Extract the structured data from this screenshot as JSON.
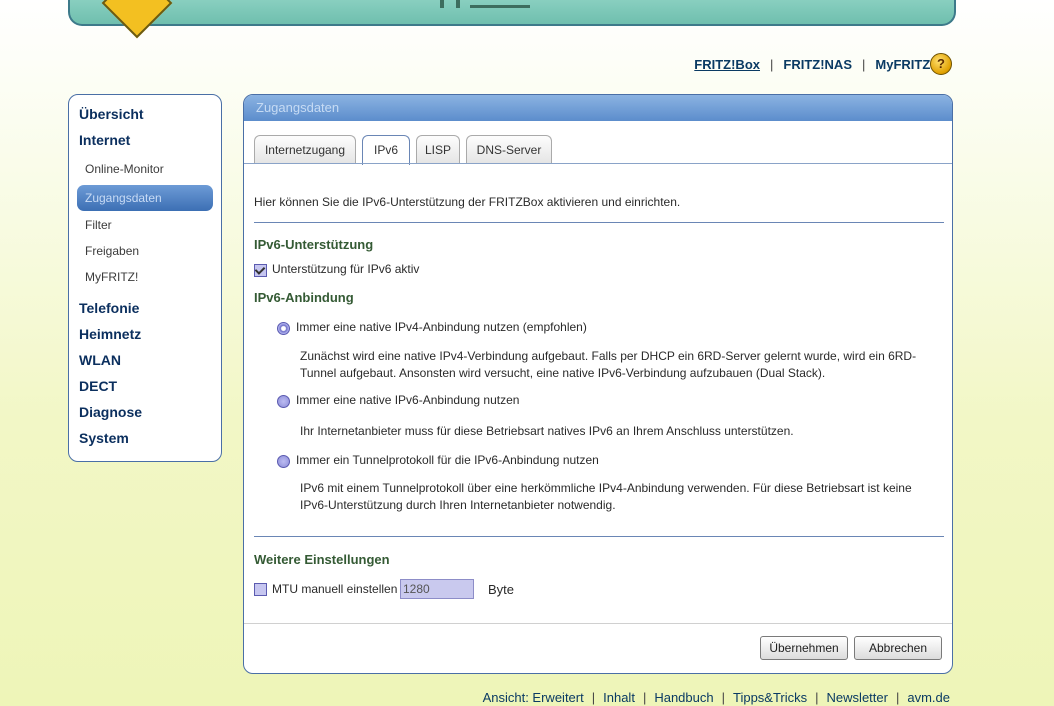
{
  "topnav": {
    "links": [
      "FRITZ!Box",
      "FRITZ!NAS",
      "MyFRITZ!"
    ],
    "separator": "|",
    "help_icon": "help-icon"
  },
  "sidebar": {
    "items": [
      {
        "label": "Übersicht"
      },
      {
        "label": "Internet"
      },
      {
        "label": "Online-Monitor"
      },
      {
        "label": "Zugangsdaten"
      },
      {
        "label": "Filter"
      },
      {
        "label": "Freigaben"
      },
      {
        "label": "MyFRITZ!"
      },
      {
        "label": "Telefonie"
      },
      {
        "label": "Heimnetz"
      },
      {
        "label": "WLAN"
      },
      {
        "label": "DECT"
      },
      {
        "label": "Diagnose"
      },
      {
        "label": "System"
      }
    ],
    "selected": "Zugangsdaten"
  },
  "panel": {
    "title": "Zugangsdaten",
    "tabs": [
      {
        "label": "Internetzugang"
      },
      {
        "label": "IPv6"
      },
      {
        "label": "LISP"
      },
      {
        "label": "DNS-Server"
      }
    ],
    "active_tab": "IPv6",
    "intro": "Hier können Sie die IPv6-Unterstützung der FRITZBox aktivieren und einrichten.",
    "support_heading": "IPv6-Unterstützung",
    "support_checkbox": {
      "label": "Unterstützung für IPv6 aktiv",
      "checked": true
    },
    "connection_heading": "IPv6-Anbindung",
    "options": [
      {
        "label": "Immer eine native IPv4-Anbindung nutzen (empfohlen)",
        "checked": true,
        "description": "Zunächst wird eine native IPv4-Verbindung aufgebaut. Falls per DHCP ein 6RD-Server gelernt wurde, wird ein 6RD-Tunnel aufgebaut. Ansonsten wird versucht, eine native IPv6-Verbindung aufzubauen (Dual Stack)."
      },
      {
        "label": "Immer eine native IPv6-Anbindung nutzen",
        "checked": false,
        "description": "Ihr Internetanbieter muss für diese Betriebsart natives IPv6 an Ihrem Anschluss unterstützen."
      },
      {
        "label": "Immer ein Tunnelprotokoll für die IPv6-Anbindung nutzen",
        "checked": false,
        "description": "IPv6 mit einem Tunnelprotokoll über eine herkömmliche IPv4-Anbindung verwenden. Für diese Betriebsart ist keine IPv6-Unterstützung durch Ihren Internetanbieter notwendig."
      }
    ],
    "more_heading": "Weitere Einstellungen",
    "mtu": {
      "label": "MTU manuell einstellen",
      "value": "1280",
      "unit": "Byte",
      "checked": false
    },
    "apply_label": "Übernehmen",
    "cancel_label": "Abbrechen"
  },
  "footer": {
    "prefix": "Ansicht: Erweitert",
    "links": [
      "Inhalt",
      "Handbuch",
      "Tipps&Tricks",
      "Newsletter",
      "avm.de"
    ],
    "separator": "|"
  },
  "colors": {
    "nav_text": "#0a3a63",
    "sidebar_selected": "#3c6fb4",
    "panel_title_bg": "#5c8dcc",
    "heading_green": "#345a34"
  }
}
